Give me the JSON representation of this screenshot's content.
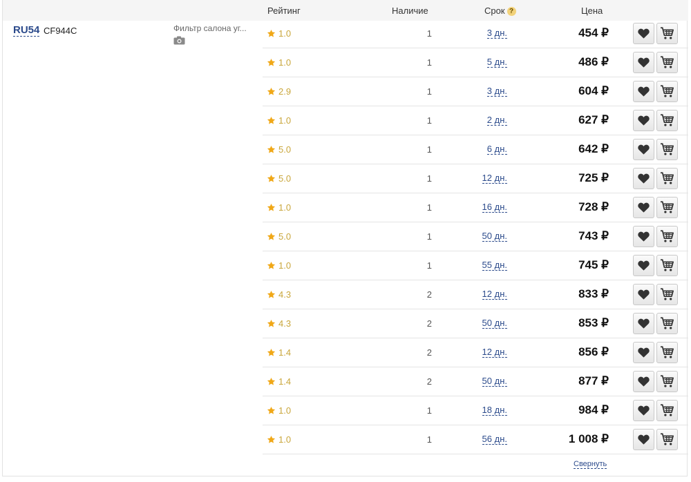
{
  "header": {
    "rating": "Рейтинг",
    "stock": "Наличие",
    "term": "Срок",
    "term_help": "?",
    "price": "Цена"
  },
  "product": {
    "brand": "RU54",
    "article": "CF944C",
    "description": "Фильтр салона уг...",
    "photo_icon": "camera-icon"
  },
  "offers": [
    {
      "rating": "1.0",
      "stock": "1",
      "term": "3 дн.",
      "price": "454 ₽"
    },
    {
      "rating": "1.0",
      "stock": "1",
      "term": "5 дн.",
      "price": "486 ₽"
    },
    {
      "rating": "2.9",
      "stock": "1",
      "term": "3 дн.",
      "price": "604 ₽"
    },
    {
      "rating": "1.0",
      "stock": "1",
      "term": "2 дн.",
      "price": "627 ₽"
    },
    {
      "rating": "5.0",
      "stock": "1",
      "term": "6 дн.",
      "price": "642 ₽"
    },
    {
      "rating": "5.0",
      "stock": "1",
      "term": "12 дн.",
      "price": "725 ₽"
    },
    {
      "rating": "1.0",
      "stock": "1",
      "term": "16 дн.",
      "price": "728 ₽"
    },
    {
      "rating": "5.0",
      "stock": "1",
      "term": "50 дн.",
      "price": "743 ₽"
    },
    {
      "rating": "1.0",
      "stock": "1",
      "term": "55 дн.",
      "price": "745 ₽"
    },
    {
      "rating": "4.3",
      "stock": "2",
      "term": "12 дн.",
      "price": "833 ₽"
    },
    {
      "rating": "4.3",
      "stock": "2",
      "term": "50 дн.",
      "price": "853 ₽"
    },
    {
      "rating": "1.4",
      "stock": "2",
      "term": "12 дн.",
      "price": "856 ₽"
    },
    {
      "rating": "1.4",
      "stock": "2",
      "term": "50 дн.",
      "price": "877 ₽"
    },
    {
      "rating": "1.0",
      "stock": "1",
      "term": "18 дн.",
      "price": "984 ₽"
    },
    {
      "rating": "1.0",
      "stock": "1",
      "term": "56 дн.",
      "price": "1 008 ₽"
    }
  ],
  "icons": {
    "rating": "star-icon",
    "favorite": "heart-icon",
    "cart": "cart-icon"
  },
  "footer": {
    "collapse_label": "Свернуть"
  },
  "colors": {
    "link": "#2b4a8b",
    "star": "#f0a818",
    "header_bg": "#f5f5f5"
  }
}
